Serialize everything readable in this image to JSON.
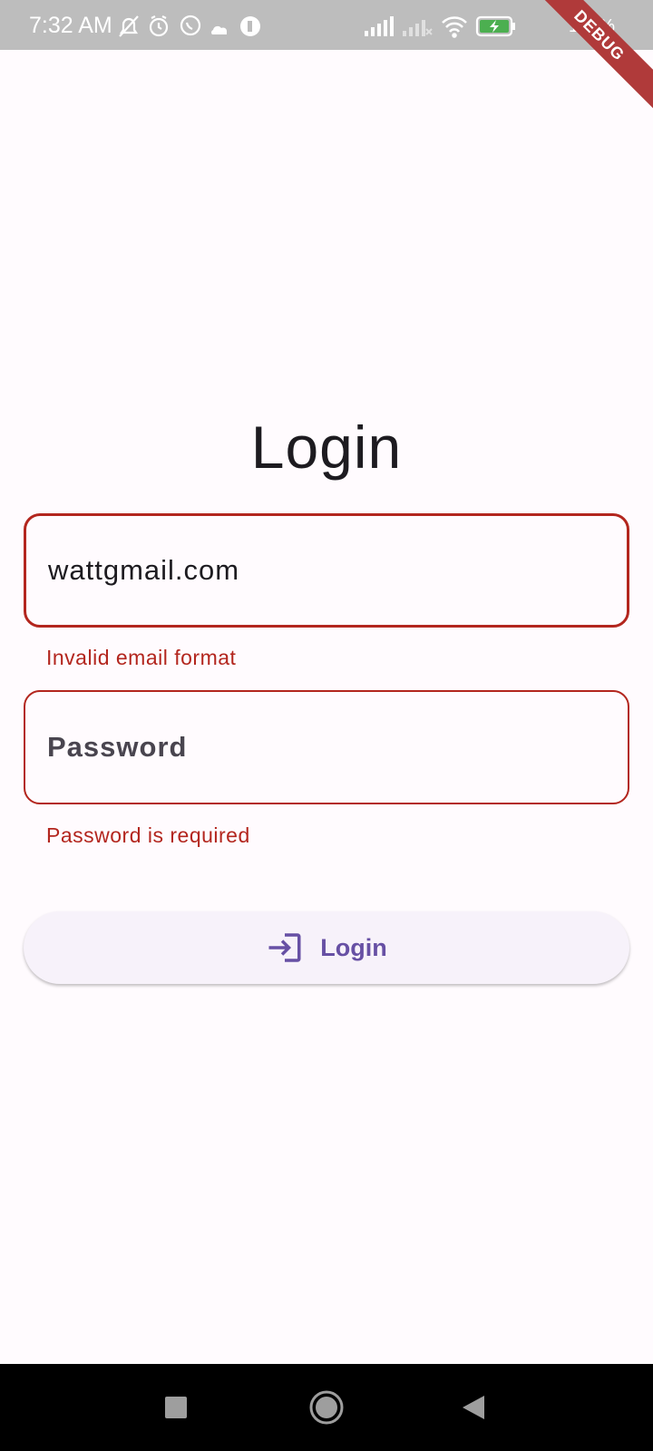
{
  "status_bar": {
    "time": "7:32 AM",
    "battery_percent": "100%",
    "left_icons": [
      "bell-off-icon",
      "alarm-icon",
      "whatsapp-icon",
      "cloud-icon",
      "circle-app-icon"
    ],
    "right_icons": [
      "signal-icon",
      "signal-off-icon",
      "wifi-icon",
      "battery-charging-icon"
    ]
  },
  "debug_banner": "DEBUG",
  "login_form": {
    "title": "Login",
    "email_value": "wattgmail.com",
    "email_error": "Invalid email format",
    "password_placeholder": "Password",
    "password_error": "Password is required",
    "submit_label": "Login"
  },
  "colors": {
    "background": "#fffbfe",
    "error": "#b3261e",
    "primary": "#6750a4",
    "button_bg": "#f7f2fa"
  },
  "nav_bar": {
    "buttons": [
      "recents-square-icon",
      "home-circle-icon",
      "back-triangle-icon"
    ]
  }
}
